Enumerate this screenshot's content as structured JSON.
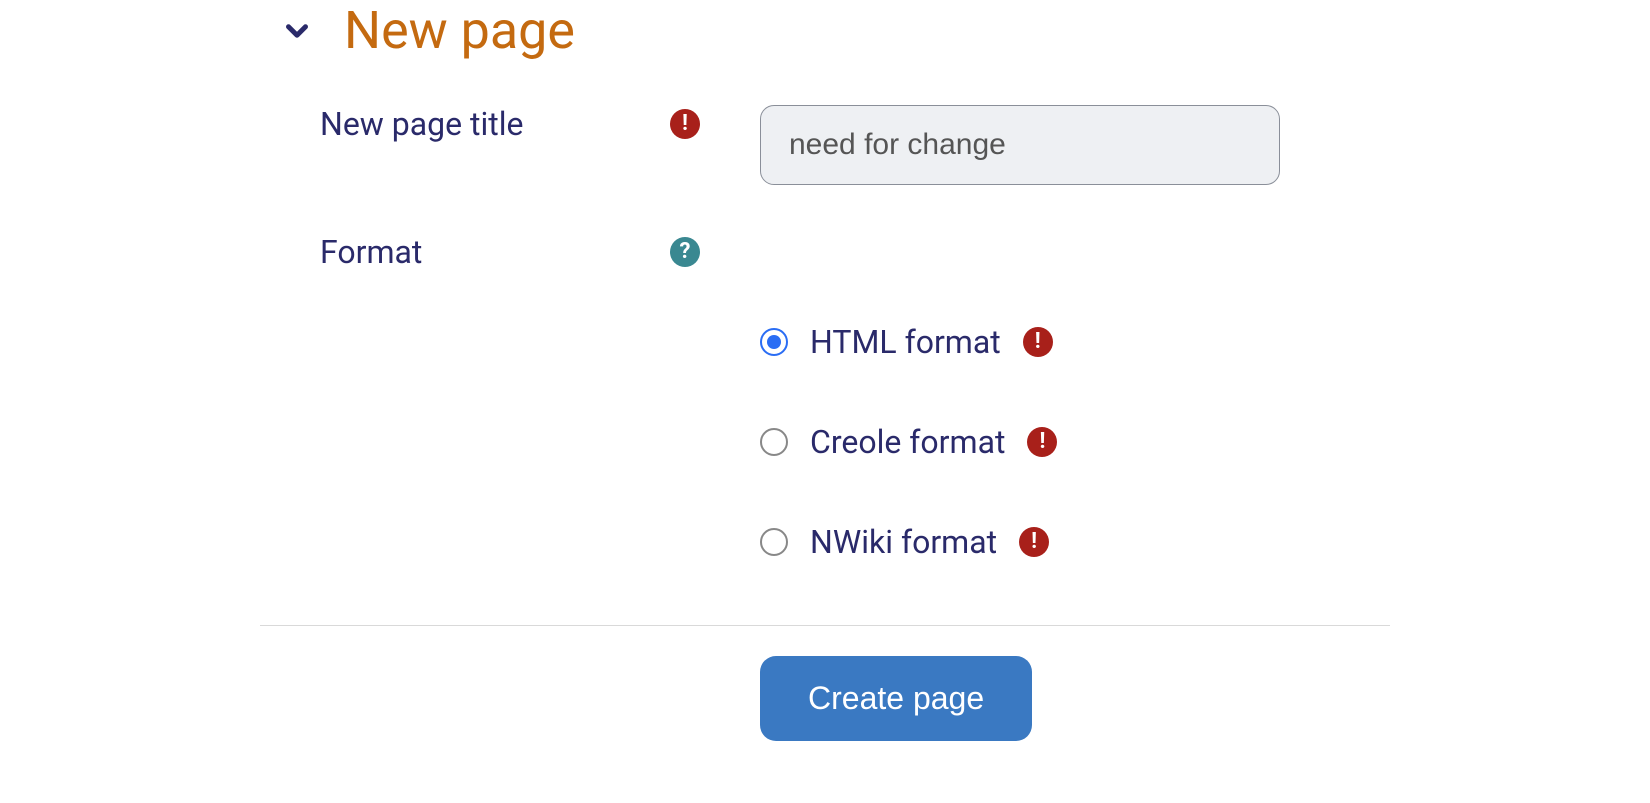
{
  "section": {
    "title": "New page"
  },
  "fields": {
    "title": {
      "label": "New page title",
      "value": "need for change"
    },
    "format": {
      "label": "Format",
      "options": [
        {
          "label": "HTML format",
          "checked": true
        },
        {
          "label": "Creole format",
          "checked": false
        },
        {
          "label": "NWiki format",
          "checked": false
        }
      ]
    }
  },
  "icons": {
    "required": "!",
    "help": "?"
  },
  "actions": {
    "submit": "Create page"
  }
}
